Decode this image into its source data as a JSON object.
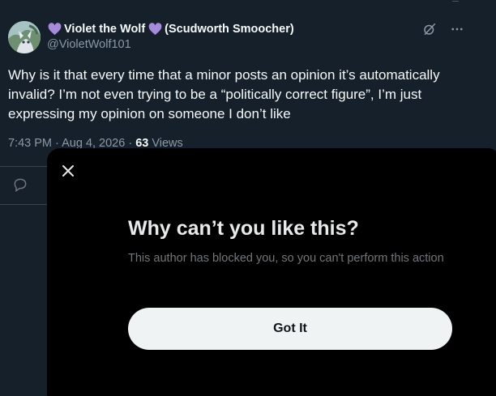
{
  "tweet": {
    "author_name": "Violet the Wolf",
    "author_name_suffix": "(Scudworth Smoocher)",
    "handle": "@VioletWolf101",
    "text": "Why is it that every time that a minor posts an opinion it’s automatically invalid? I’m not even trying to be a “politically correct figure”, I’m just expressing my opinion on someone I don’t like",
    "timestamp": "7:43 PM · Aug 4, 2026 · ",
    "views_count": "63",
    "views_label": " Views"
  },
  "modal": {
    "title": "Why can’t you like this?",
    "description": "This author has blocked you, so you can't perform this action",
    "button_label": "Got It"
  },
  "colors": {
    "background": "#15202b",
    "modal_background": "#000000",
    "heart": "#a78bdb",
    "button": "#eff3f4",
    "muted_text": "#8b98a5"
  },
  "icons": [
    "heart-icon",
    "grok-icon",
    "more-icon",
    "reply-icon",
    "close-icon"
  ]
}
